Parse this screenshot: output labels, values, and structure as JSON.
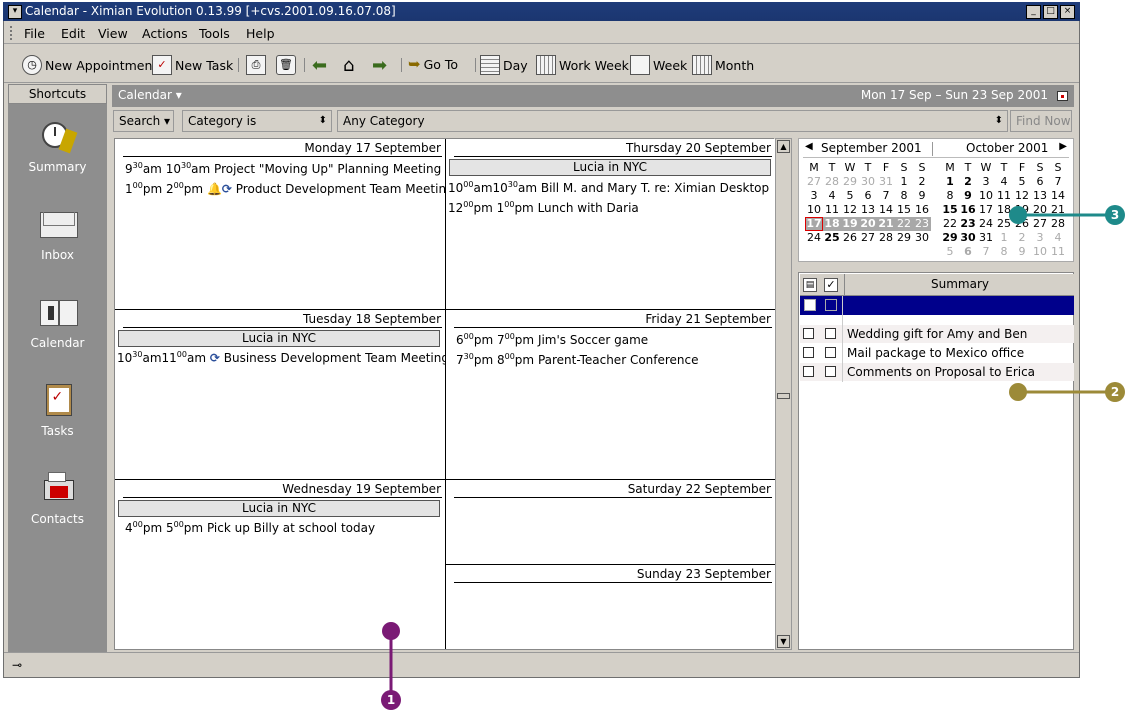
{
  "window": {
    "title": "Calendar - Ximian Evolution 0.13.99 [+cvs.2001.09.16.07.08]"
  },
  "menu": [
    "File",
    "Edit",
    "View",
    "Actions",
    "Tools",
    "Help"
  ],
  "toolbar": {
    "new_appointment": "New Appointment",
    "new_task": "New Task",
    "go_to": "Go To",
    "day": "Day",
    "work_week": "Work Week",
    "week": "Week",
    "month": "Month"
  },
  "shortcuts": {
    "header": "Shortcuts",
    "items": [
      {
        "label": "Summary",
        "icon": "summary-icon"
      },
      {
        "label": "Inbox",
        "icon": "inbox-icon"
      },
      {
        "label": "Calendar",
        "icon": "calendar-icon"
      },
      {
        "label": "Tasks",
        "icon": "tasks-icon"
      },
      {
        "label": "Contacts",
        "icon": "contacts-icon"
      }
    ]
  },
  "calendar_header": {
    "title": "Calendar ▾",
    "range": "Mon 17 Sep – Sun 23 Sep 2001"
  },
  "search": {
    "search_label": "Search ▾",
    "field": "Category is",
    "value": "Any Category",
    "find_now": "Find Now"
  },
  "days": {
    "mon": {
      "header": "Monday 17 September",
      "events": [
        {
          "start_h": "9",
          "start_m": "30",
          "start_ap": "am",
          "end_h": "10",
          "end_m": "30",
          "end_ap": "am",
          "title": "Project \"Moving Up\" Planning Meeting"
        },
        {
          "start_h": "1",
          "start_m": "00",
          "start_ap": "pm",
          "end_h": "2",
          "end_m": "00",
          "end_ap": "pm",
          "title": "Product Development Team Meeting"
        }
      ]
    },
    "tue": {
      "header": "Tuesday 18 September",
      "banner": "Lucia in NYC",
      "events": [
        {
          "start_h": "10",
          "start_m": "30",
          "start_ap": "am",
          "end_h": "11",
          "end_m": "00",
          "end_ap": "am",
          "title": "Business Development Team Meeting"
        }
      ]
    },
    "wed": {
      "header": "Wednesday 19 September",
      "banner": "Lucia in NYC",
      "events": [
        {
          "start_h": "4",
          "start_m": "00",
          "start_ap": "pm",
          "end_h": "5",
          "end_m": "00",
          "end_ap": "pm",
          "title": "Pick up Billy at school today"
        }
      ]
    },
    "thu": {
      "header": "Thursday 20 September",
      "banner": "Lucia in NYC",
      "events": [
        {
          "start_h": "10",
          "start_m": "00",
          "start_ap": "am",
          "end_h": "10",
          "end_m": "30",
          "end_ap": "am",
          "title": "Bill M. and Mary T. re: Ximian Desktop"
        },
        {
          "start_h": "12",
          "start_m": "00",
          "start_ap": "pm",
          "end_h": "1",
          "end_m": "00",
          "end_ap": "pm",
          "title": "Lunch with Daria"
        }
      ]
    },
    "fri": {
      "header": "Friday 21 September",
      "events": [
        {
          "start_h": "6",
          "start_m": "00",
          "start_ap": "pm",
          "end_h": "7",
          "end_m": "00",
          "end_ap": "pm",
          "title": "Jim's Soccer game"
        },
        {
          "start_h": "7",
          "start_m": "30",
          "start_ap": "pm",
          "end_h": "8",
          "end_m": "00",
          "end_ap": "pm",
          "title": "Parent-Teacher Conference"
        }
      ]
    },
    "sat": {
      "header": "Saturday 22 September"
    },
    "sun": {
      "header": "Sunday 23 September"
    }
  },
  "mini_calendar": {
    "left_month": "September 2001",
    "right_month": "October 2001",
    "weekday_letters": [
      "M",
      "T",
      "W",
      "T",
      "F",
      "S",
      "S"
    ],
    "sep_weeks": [
      [
        "27",
        "28",
        "29",
        "30",
        "31",
        "1",
        "2"
      ],
      [
        "3",
        "4",
        "5",
        "6",
        "7",
        "8",
        "9"
      ],
      [
        "10",
        "11",
        "12",
        "13",
        "14",
        "15",
        "16"
      ],
      [
        "17",
        "18",
        "19",
        "20",
        "21",
        "22",
        "23"
      ],
      [
        "24",
        "25",
        "26",
        "27",
        "28",
        "29",
        "30"
      ]
    ],
    "oct_weeks": [
      [
        "1",
        "2",
        "3",
        "4",
        "5",
        "6",
        "7"
      ],
      [
        "8",
        "9",
        "10",
        "11",
        "12",
        "13",
        "14"
      ],
      [
        "15",
        "16",
        "17",
        "18",
        "19",
        "20",
        "21"
      ],
      [
        "22",
        "23",
        "24",
        "25",
        "26",
        "27",
        "28"
      ],
      [
        "29",
        "30",
        "31",
        "1",
        "2",
        "3",
        "4"
      ],
      [
        "5",
        "6",
        "7",
        "8",
        "9",
        "10",
        "11"
      ]
    ]
  },
  "tasks": {
    "summary_header": "Summary",
    "items": [
      "Wedding gift for Amy and Ben",
      "Mail package to Mexico office",
      "Comments on Proposal to Erica"
    ]
  },
  "callouts": {
    "c1": "1",
    "c2": "2",
    "c3": "3"
  },
  "colors": {
    "selection": "#00008b",
    "callout1": "#7a1a75",
    "callout2": "#9c8a38",
    "callout3": "#1e8a8a"
  }
}
